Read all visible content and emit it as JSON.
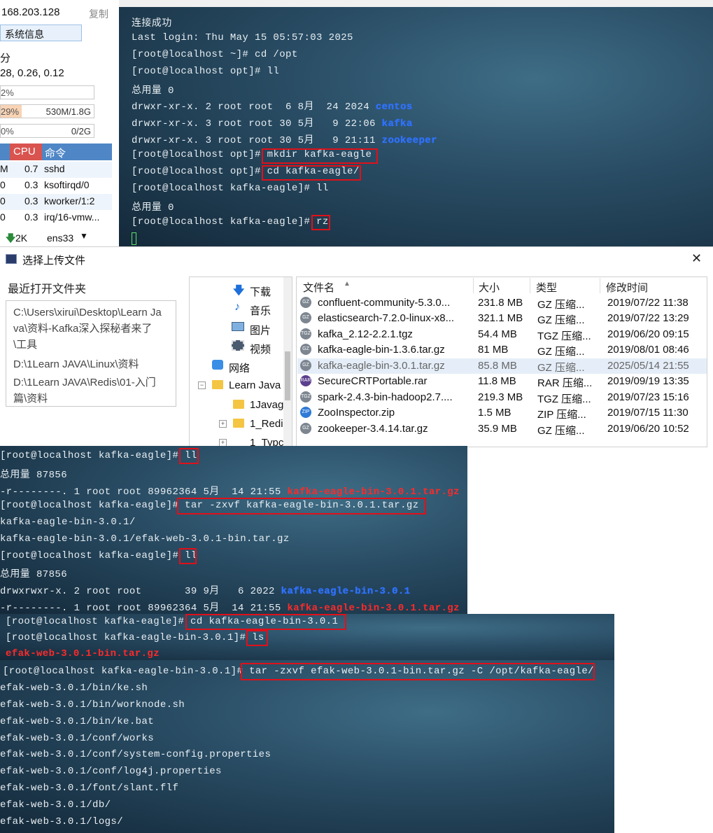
{
  "left_panel": {
    "ip": "168.203.128",
    "copy": "复制",
    "sysinfo_btn": "系统信息",
    "load_label": "分",
    "load_values": "28, 0.26, 0.12",
    "cpu_bar": "2%",
    "mem_pct": "29%",
    "mem_val": "530M/1.8G",
    "swap_pct": "0%",
    "swap_val": "0/2G",
    "col_cpu": "CPU",
    "col_cmd": "命令",
    "processes": [
      {
        "mem": "M",
        "cpu": "0.7",
        "cmd": "sshd"
      },
      {
        "mem": "0",
        "cpu": "0.3",
        "cmd": "ksoftirqd/0"
      },
      {
        "mem": "0",
        "cpu": "0.3",
        "cmd": "kworker/1:2"
      },
      {
        "mem": "0",
        "cpu": "0.3",
        "cmd": "irq/16-vmw..."
      }
    ],
    "net_speed": "2K",
    "net_iface": "ens33"
  },
  "terminal1": {
    "l1": "连接成功",
    "l2": "Last login: Thu May 15 05:57:03 2025",
    "l3": "[root@localhost ~]# cd /opt",
    "l4": "[root@localhost opt]# ll",
    "l5": "总用量 0",
    "l6a": "drwxr-xr-x. 2 root root  6 8月  24 2024 ",
    "l6b": "centos",
    "l7a": "drwxr-xr-x. 3 root root 30 5月   9 22:06 ",
    "l7b": "kafka",
    "l8a": "drwxr-xr-x. 3 root root 30 5月   9 21:11 ",
    "l8b": "zookeeper",
    "l9a": "[root@localhost opt]# ",
    "l9b": "mkdir kafka-eagle",
    "l10a": "[root@localhost opt]# ",
    "l10b": "cd kafka-eagle/",
    "l11": "[root@localhost kafka-eagle]# ll",
    "l12": "总用量 0",
    "l13a": "[root@localhost kafka-eagle]# ",
    "l13b": "rz"
  },
  "dialog": {
    "title": "选择上传文件",
    "close": "✕",
    "recent_title": "最近打开文件夹",
    "recent": [
      "C:\\Users\\xirui\\Desktop\\Learn Java\\资料-Kafka深入探秘者来了\\工具",
      "D:\\1Learn JAVA\\Linux\\资料",
      "D:\\1Learn JAVA\\Redis\\01-入门篇\\资料"
    ],
    "tree": [
      "下载",
      "音乐",
      "图片",
      "视频",
      "网络",
      "Learn Java",
      "1Javag",
      "1_Redi",
      "1_Typc"
    ],
    "columns": {
      "name": "文件名",
      "size": "大小",
      "type": "类型",
      "modified": "修改时间"
    },
    "files": [
      {
        "icon": "GZ",
        "name": "confluent-community-5.3.0...",
        "size": "231.8 MB",
        "type": "GZ 压缩...",
        "modified": "2019/07/22 11:38"
      },
      {
        "icon": "GZ",
        "name": "elasticsearch-7.2.0-linux-x8...",
        "size": "321.1 MB",
        "type": "GZ 压缩...",
        "modified": "2019/07/22 13:29"
      },
      {
        "icon": "TGZ",
        "name": "kafka_2.12-2.2.1.tgz",
        "size": "54.4 MB",
        "type": "TGZ 压缩...",
        "modified": "2019/06/20 09:15"
      },
      {
        "icon": "GZ",
        "name": "kafka-eagle-bin-1.3.6.tar.gz",
        "size": "81 MB",
        "type": "GZ 压缩...",
        "modified": "2019/08/01 08:46"
      },
      {
        "icon": "GZ",
        "name": "kafka-eagle-bin-3.0.1.tar.gz",
        "size": "85.8 MB",
        "type": "GZ 压缩...",
        "modified": "2025/05/14 21:55"
      },
      {
        "icon": "RAR",
        "name": "SecureCRTPortable.rar",
        "size": "11.8 MB",
        "type": "RAR 压缩...",
        "modified": "2019/09/19 13:35"
      },
      {
        "icon": "TGZ",
        "name": "spark-2.4.3-bin-hadoop2.7....",
        "size": "219.3 MB",
        "type": "TGZ 压缩...",
        "modified": "2019/07/23 15:16"
      },
      {
        "icon": "ZIP",
        "name": "ZooInspector.zip",
        "size": "1.5 MB",
        "type": "ZIP 压缩...",
        "modified": "2019/07/15 11:30"
      },
      {
        "icon": "GZ",
        "name": "zookeeper-3.4.14.tar.gz",
        "size": "35.9 MB",
        "type": "GZ 压缩...",
        "modified": "2019/06/20 10:52"
      }
    ]
  },
  "terminal2": {
    "l1a": "[root@localhost kafka-eagle]# ",
    "l1b": "ll",
    "l2": "总用量 87856",
    "l3a": "-r--------. 1 root root 89962364 5月  14 21:55 ",
    "l3b": "kafka-eagle-bin-3.0.1.tar.gz",
    "l4a": "[root@localhost kafka-eagle]# ",
    "l4b": "tar -zxvf kafka-eagle-bin-3.0.1.tar.gz",
    "l5": "kafka-eagle-bin-3.0.1/",
    "l6": "kafka-eagle-bin-3.0.1/efak-web-3.0.1-bin.tar.gz",
    "l7a": "[root@localhost kafka-eagle]# ",
    "l7b": "ll",
    "l8": "总用量 87856",
    "l9a": "drwxrwxr-x. 2 root root       39 9月   6 2022 ",
    "l9b": "kafka-eagle-bin-3.0.1",
    "l10a": "-r--------. 1 root root 89962364 5月  14 21:55 ",
    "l10b": "kafka-eagle-bin-3.0.1.tar.gz"
  },
  "terminal3": {
    "l1a": "[root@localhost kafka-eagle]# ",
    "l1b": "cd kafka-eagle-bin-3.0.1",
    "l2a": "[root@localhost kafka-eagle-bin-3.0.1]# ",
    "l2b": "ls",
    "l3": "efak-web-3.0.1-bin.tar.gz"
  },
  "terminal4": {
    "l1a": "[root@localhost kafka-eagle-bin-3.0.1]# ",
    "l1b": "tar -zxvf efak-web-3.0.1-bin.tar.gz -C /opt/kafka-eagle/",
    "lines": [
      "efak-web-3.0.1/bin/ke.sh",
      "efak-web-3.0.1/bin/worknode.sh",
      "efak-web-3.0.1/bin/ke.bat",
      "efak-web-3.0.1/conf/works",
      "efak-web-3.0.1/conf/system-config.properties",
      "efak-web-3.0.1/conf/log4j.properties",
      "efak-web-3.0.1/font/slant.flf",
      "efak-web-3.0.1/db/",
      "efak-web-3.0.1/logs/"
    ]
  }
}
